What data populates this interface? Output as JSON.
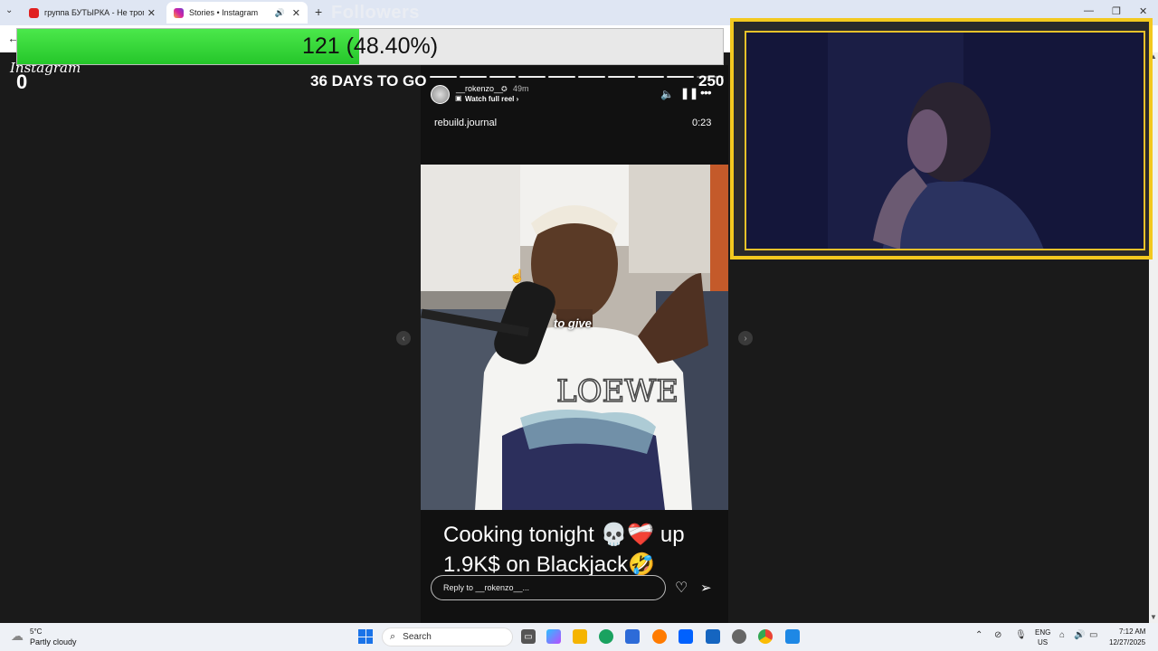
{
  "browser": {
    "tabs": [
      {
        "label": "группа БУТЫРКА - Не трогай с",
        "favicon_color": "#e02020"
      },
      {
        "label": "Stories • Instagram",
        "favicon_color": "#d6249f"
      }
    ]
  },
  "overlay": {
    "followers_title": "Followers",
    "progress_text": "121 (48.40%)",
    "progress_fraction": 0.484,
    "instagram_logo": "Instagram",
    "goal_start": "0",
    "days_to_go": "36 DAYS TO GO",
    "goal_end": "250"
  },
  "story": {
    "username": "__rokenzo__",
    "time_ago": "49m",
    "watch_reel": "Watch full reel",
    "reel_handle": "rebuild.journal",
    "reel_duration": "0:23",
    "subtitle": "to give",
    "caption": "Cooking tonight 💀❤️‍🩹 up 1.9K$ on Blackjack🤣",
    "reply_placeholder": "Reply to __rokenzo__...",
    "progress_segments_total": 10,
    "progress_segments_done": 9
  },
  "taskbar": {
    "weather_temp": "5°C",
    "weather_desc": "Partly cloudy",
    "search_placeholder": "Search",
    "lang_line1": "ENG",
    "lang_line2": "US",
    "time": "7:12 AM",
    "date": "12/27/2025"
  },
  "colors": {
    "progress_green": "#2fd12f",
    "webcam_frame": "#f3c91f"
  }
}
